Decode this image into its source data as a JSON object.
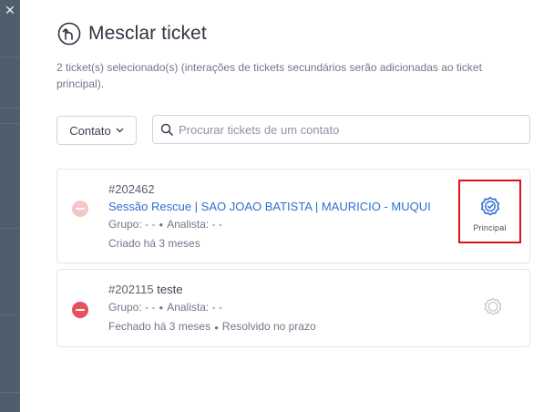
{
  "backdrop": {
    "close_glyph": "✕"
  },
  "header": {
    "title": "Mesclar ticket",
    "icon": "merge-icon",
    "subtitle": "2 ticket(s) selecionado(s) (interações de tickets secundários serão adicionadas ao ticket principal)."
  },
  "filter": {
    "contact_label": "Contato",
    "search_placeholder": "Procurar tickets de um contato"
  },
  "colors": {
    "accent_blue": "#2f6fd0",
    "remove_red": "#e8505b",
    "remove_red_faded": "#f7c5c9",
    "highlight_red": "#e0101a"
  },
  "tickets": [
    {
      "id": "#202462",
      "description": "",
      "subject": "Sessão Rescue | SAO JOAO BATISTA | MAURICIO - MUQUI",
      "grupo": "Grupo: - -",
      "analista": "Analista: - -",
      "status": "Criado há 3 meses",
      "extra": "",
      "principal": true,
      "principal_label": "Principal"
    },
    {
      "id": "#202115",
      "description": "teste",
      "subject": "",
      "grupo": "Grupo: - -",
      "analista": "Analista: - -",
      "status": "Fechado há 3 meses",
      "extra": "Resolvido no prazo",
      "principal": false
    }
  ]
}
